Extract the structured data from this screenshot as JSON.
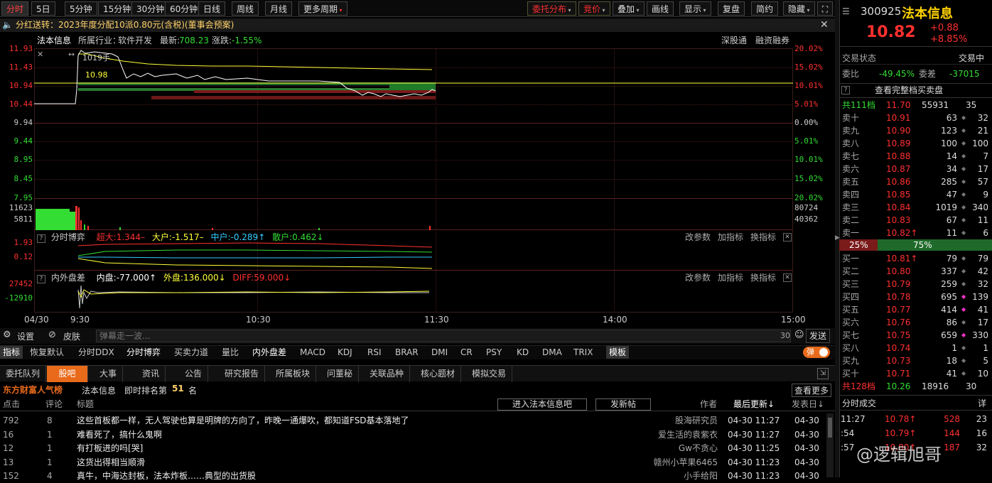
{
  "toolbar": {
    "periods": [
      "分时",
      "5日",
      "5分钟",
      "15分钟",
      "30分钟",
      "60分钟",
      "日线",
      "周线",
      "月线",
      "更多周期"
    ],
    "right_btns": [
      "委托分布",
      "竞价",
      "叠加",
      "画线",
      "显示",
      "复盘",
      "简约",
      "隐藏"
    ]
  },
  "notice": {
    "text": "分红送转：2023年度分配10派0.80元(含税)(董事会预案)"
  },
  "info": {
    "name": "法本信息",
    "industry_label": "所属行业：",
    "industry": "软件开发",
    "latest_label": "最新:",
    "latest": "708.23",
    "change_label": "涨跌:",
    "change": "-1.55%",
    "links": [
      "深股通",
      "融资融券"
    ]
  },
  "price_axis": {
    "left": [
      "11.93",
      "11.43",
      "10.94",
      "10.44",
      "9.94",
      "9.44",
      "8.95",
      "8.45",
      "7.95"
    ],
    "right": [
      "20.02%",
      "15.02%",
      "10.01%",
      "5.01%",
      "0.00%",
      "5.01%",
      "10.01%",
      "15.02%",
      "20.02%"
    ]
  },
  "chart_labels": {
    "volume_tag": "1019手",
    "price_tag": "10.98"
  },
  "volume_axis": {
    "left": [
      "11623",
      "5811"
    ],
    "right": [
      "80724",
      "40362"
    ]
  },
  "bo_yi": {
    "title": "分时博弈",
    "super": "超大:1.344",
    "large": "大户:-1.517",
    "mid": "中户:-0.289",
    "retail": "散户:0.462",
    "axis": [
      "1.93",
      "0.12"
    ]
  },
  "neiwai": {
    "title": "内外盘差",
    "inner": "内盘:-77.000",
    "outer": "外盘:136.000",
    "diff": "DIFF:59.000",
    "axis": [
      "27452",
      "-12910"
    ]
  },
  "sub_actions": [
    "改参数",
    "加指标",
    "换指标"
  ],
  "time_axis": [
    "04/30",
    "9:30",
    "10:30",
    "11:30",
    "14:00",
    "15:00"
  ],
  "chat": {
    "settings": "设置",
    "skin": "皮肤",
    "placeholder": "弹幕走一波...",
    "count": "30",
    "send": "发送"
  },
  "indicators": [
    "指标",
    "恢复默认",
    "分时DDX",
    "分时博弈",
    "买卖力道",
    "量比",
    "内外盘差",
    "MACD",
    "KDJ",
    "RSI",
    "BRAR",
    "DMI",
    "CR",
    "PSY",
    "KD",
    "DMA",
    "TRIX",
    "模板"
  ],
  "popup_toggle": "弹",
  "tabs": [
    "委托队列",
    "股吧",
    "大事",
    "资讯",
    "公告",
    "研究报告",
    "所属板块",
    "问董秘",
    "关联品种",
    "核心题材",
    "模拟交易"
  ],
  "forum": {
    "brand": "东方财富人气榜",
    "stock": "法本信息",
    "rank_label": "即时排名第",
    "rank": "51",
    "rank_unit": "名",
    "more": "查看更多",
    "headers": [
      "点击",
      "评论",
      "标题",
      "作者",
      "最后更新↓",
      "发表日↓"
    ],
    "enter_btn": "进入法本信息吧",
    "post_btn": "发新帖",
    "rows": [
      {
        "clicks": "792",
        "comments": "8",
        "title": "这些首板都一样，无人驾驶也算是明牌的方向了，昨晚一通爆吹，都知道FSD基本落地了",
        "author": "股海研究员",
        "updated": "04-30 11:27",
        "posted": "04-30"
      },
      {
        "clicks": "16",
        "comments": "1",
        "title": "难看死了，搞什么鬼啊",
        "author": "爱生活的袁紫衣",
        "updated": "04-30 11:27",
        "posted": "04-30"
      },
      {
        "clicks": "12",
        "comments": "1",
        "title": "有打板进的吗[哭]",
        "author": "Gw不贪心",
        "updated": "04-30 11:25",
        "posted": "04-30"
      },
      {
        "clicks": "13",
        "comments": "1",
        "title": "这货出得相当顺滑",
        "author": "赣州小苹果6465",
        "updated": "04-30 11:23",
        "posted": "04-30"
      },
      {
        "clicks": "152",
        "comments": "4",
        "title": "真牛，中海达封板，法本炸板……典型的出货股",
        "author": "小手给阳",
        "updated": "04-30 11:23",
        "posted": "04-30"
      }
    ]
  },
  "quote": {
    "code": "300925",
    "name": "法本信息",
    "price": "10.82",
    "change": "+0.88",
    "pct": "+8.85%",
    "status_label": "交易状态",
    "status": "交易中",
    "wb_label": "委比",
    "wb": "-49.45%",
    "wc_label": "委差",
    "wc": "-37015",
    "full_book": "查看完整档买卖盘"
  },
  "asks_total": {
    "label": "共111档",
    "price": "11.70",
    "vol": "55931",
    "n": "35"
  },
  "asks": [
    {
      "l": "卖十",
      "p": "10.91",
      "v": "63",
      "n": "32"
    },
    {
      "l": "卖九",
      "p": "10.90",
      "v": "123",
      "n": "21"
    },
    {
      "l": "卖八",
      "p": "10.89",
      "v": "100",
      "n": "100"
    },
    {
      "l": "卖七",
      "p": "10.88",
      "v": "14",
      "n": "7"
    },
    {
      "l": "卖六",
      "p": "10.87",
      "v": "34",
      "n": "17"
    },
    {
      "l": "卖五",
      "p": "10.86",
      "v": "285",
      "n": "57"
    },
    {
      "l": "卖四",
      "p": "10.85",
      "v": "47",
      "n": "9"
    },
    {
      "l": "卖三",
      "p": "10.84",
      "v": "1019",
      "n": "340"
    },
    {
      "l": "卖二",
      "p": "10.83",
      "v": "67",
      "n": "11"
    },
    {
      "l": "卖一",
      "p": "10.82↑",
      "v": "11",
      "n": "6"
    }
  ],
  "ratio": {
    "sell": "25%",
    "buy": "75%",
    "buy_fraction": 0.75
  },
  "bids": [
    {
      "l": "买一",
      "p": "10.81↑",
      "v": "79",
      "n": "79"
    },
    {
      "l": "买二",
      "p": "10.80",
      "v": "337",
      "n": "42"
    },
    {
      "l": "买三",
      "p": "10.79",
      "v": "259",
      "n": "32"
    },
    {
      "l": "买四",
      "p": "10.78",
      "v": "695",
      "n": "139"
    },
    {
      "l": "买五",
      "p": "10.77",
      "v": "414",
      "n": "41"
    },
    {
      "l": "买六",
      "p": "10.76",
      "v": "86",
      "n": "17"
    },
    {
      "l": "买七",
      "p": "10.75",
      "v": "659",
      "n": "330"
    },
    {
      "l": "买八",
      "p": "10.74",
      "v": "1",
      "n": "1"
    },
    {
      "l": "买九",
      "p": "10.73",
      "v": "18",
      "n": "5"
    },
    {
      "l": "买十",
      "p": "10.71",
      "v": "41",
      "n": "10"
    }
  ],
  "bids_total": {
    "label": "共128档",
    "price": "10.26",
    "vol": "18916",
    "n": "30"
  },
  "ticks": {
    "title": "分时成交",
    "detail": "详",
    "rows": [
      {
        "t": "11:27",
        "p": "10.78↑",
        "v": "528",
        "n": "23"
      },
      {
        "t": ":54",
        "p": "10.79↑",
        "v": "144",
        "n": "16"
      },
      {
        "t": ":57",
        "p": "10.80↑",
        "v": "187",
        "n": "32"
      }
    ]
  },
  "watermark": "@逻辑旭哥",
  "colors": {
    "up": "#ff3030",
    "down": "#33dd33",
    "yellow": "#ffff3a",
    "accent": "#e86a1a"
  }
}
